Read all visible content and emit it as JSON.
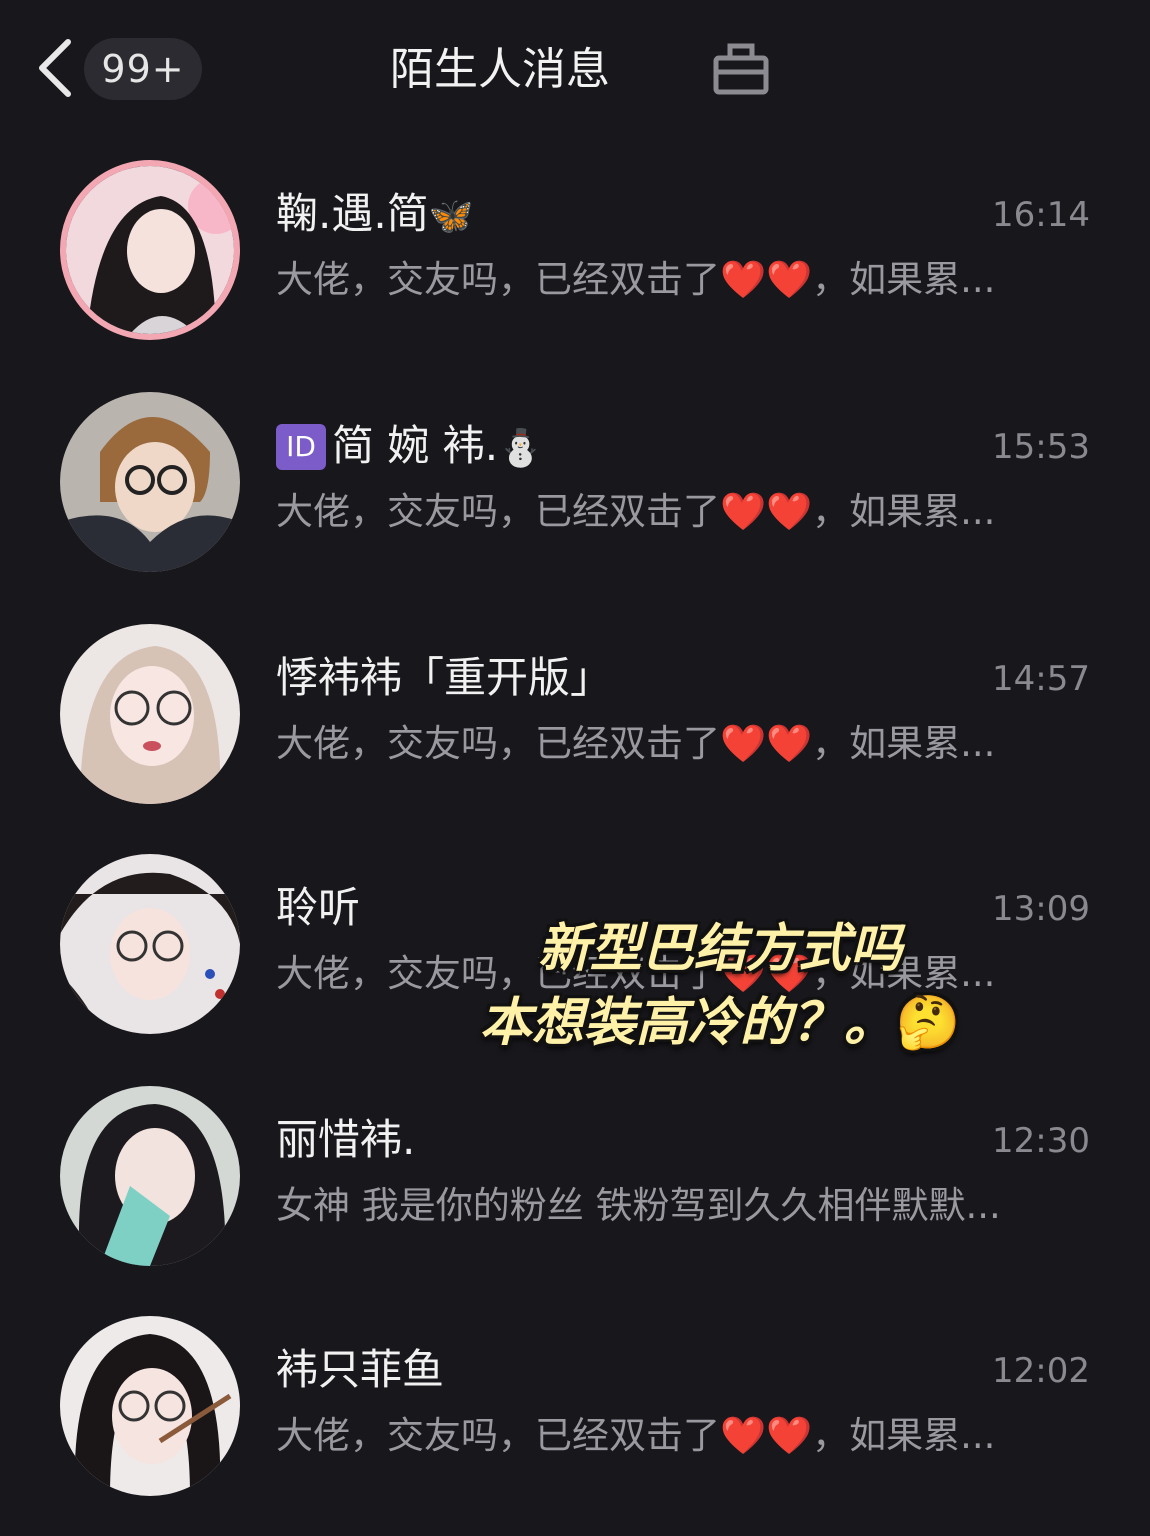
{
  "header": {
    "back_icon": "chevron-left-icon",
    "badge": "99+",
    "title": "陌生人消息",
    "box_icon": "inbox-box-icon"
  },
  "conversations": [
    {
      "name": "鞠.遇.简",
      "name_emoji": "🦋",
      "time": "16:14",
      "preview": "大佬，交友吗，已经双击了❤️❤️，如果累..."
    },
    {
      "tag": "ID",
      "name": "简 婉 袆.",
      "name_emoji": "⛄",
      "time": "15:53",
      "preview": "大佬，交友吗，已经双击了❤️❤️，如果累..."
    },
    {
      "name": "悸袆袆「重开版」",
      "time": "14:57",
      "preview": "大佬，交友吗，已经双击了❤️❤️，如果累..."
    },
    {
      "name": "聆听",
      "time": "13:09",
      "preview": "大佬，交友吗，已经双击了❤️❤️，如果累..."
    },
    {
      "name": "丽惜袆.",
      "time": "12:30",
      "preview": "女神 我是你的粉丝 铁粉驾到久久相伴默默..."
    },
    {
      "name": "袆只菲鱼",
      "time": "12:02",
      "preview": "大佬，交友吗，已经双击了❤️❤️，如果累..."
    }
  ],
  "caption": {
    "line1": "新型巴结方式吗",
    "line2": "本想装高冷的？。",
    "emoji": "🤔"
  },
  "colors": {
    "background": "#18171c",
    "badge_bg": "#2c2b31",
    "caption_text": "#fff1a8"
  }
}
